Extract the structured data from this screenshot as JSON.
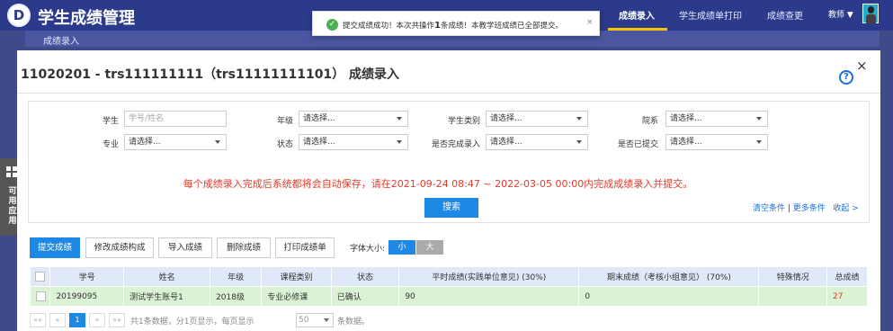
{
  "app": {
    "title": "学生成绩管理",
    "logo_glyph": "D"
  },
  "nav": {
    "items": [
      "成绩录入",
      "学生成绩单打印",
      "成绩查更"
    ],
    "active_index": 0,
    "user_role": "教师 ▼"
  },
  "toast": {
    "prefix": "提交成绩成功！本次共操作",
    "count": "1",
    "suffix": "条成绩！本教学班成绩已全部提交。",
    "close": "×"
  },
  "breadcrumb": "成绩录入",
  "side_widget": {
    "label": "可用应用"
  },
  "modal": {
    "title": "11020201 - trs111111111（trs11111111101）  成绩录入",
    "help": "?",
    "close": "×"
  },
  "filters": {
    "student": {
      "label": "学生",
      "placeholder": "学号/姓名"
    },
    "grade": {
      "label": "年级",
      "value": "请选择..."
    },
    "student_type": {
      "label": "学生类别",
      "value": "请选择..."
    },
    "department": {
      "label": "院系",
      "value": "请选择..."
    },
    "major": {
      "label": "专业",
      "value": "请选择..."
    },
    "status": {
      "label": "状态",
      "value": "请选择..."
    },
    "entry_done": {
      "label": "是否完成录入",
      "value": "请选择..."
    },
    "submitted": {
      "label": "是否已提交",
      "value": "请选择..."
    },
    "notice": "每个成绩录入完成后系统都将会自动保存，请在2021-09-24 08:47 ~ 2022-03-05 00:00内完成成绩录入并提交。",
    "search_label": "搜索",
    "clear": "清空条件",
    "more": "更多条件",
    "collapse": "收起 >"
  },
  "toolbar": {
    "submit": "提交成绩",
    "modify": "修改成绩构成",
    "import": "导入成绩",
    "delete": "删除成绩",
    "print": "打印成绩单",
    "font_size_label": "字体大小:",
    "font_small": "小",
    "font_big": "大"
  },
  "table": {
    "headers": [
      "学号",
      "姓名",
      "年级",
      "课程类别",
      "状态",
      "平时成绩(实践单位意见) (30%)",
      "期末成绩（考核小组意见） (70%)",
      "特殊情况",
      "总成绩"
    ],
    "rows": [
      [
        "20199095",
        "测试学生账号1",
        "2018级",
        "专业必修课",
        "已确认",
        "90",
        "0",
        "",
        "27"
      ]
    ]
  },
  "pager": {
    "first": "««",
    "prev": "«",
    "current": "1",
    "next": "»",
    "last": "»»",
    "summary": "共1条数据，分1页显示，每页显示",
    "page_size": "50",
    "unit": "条数据。"
  },
  "colors": {
    "primary": "#1e88e5",
    "nav_bg": "#2c3a8c",
    "row_bg": "#dcf2d4",
    "notice": "#e23b2a",
    "accent": "#ffc400"
  }
}
